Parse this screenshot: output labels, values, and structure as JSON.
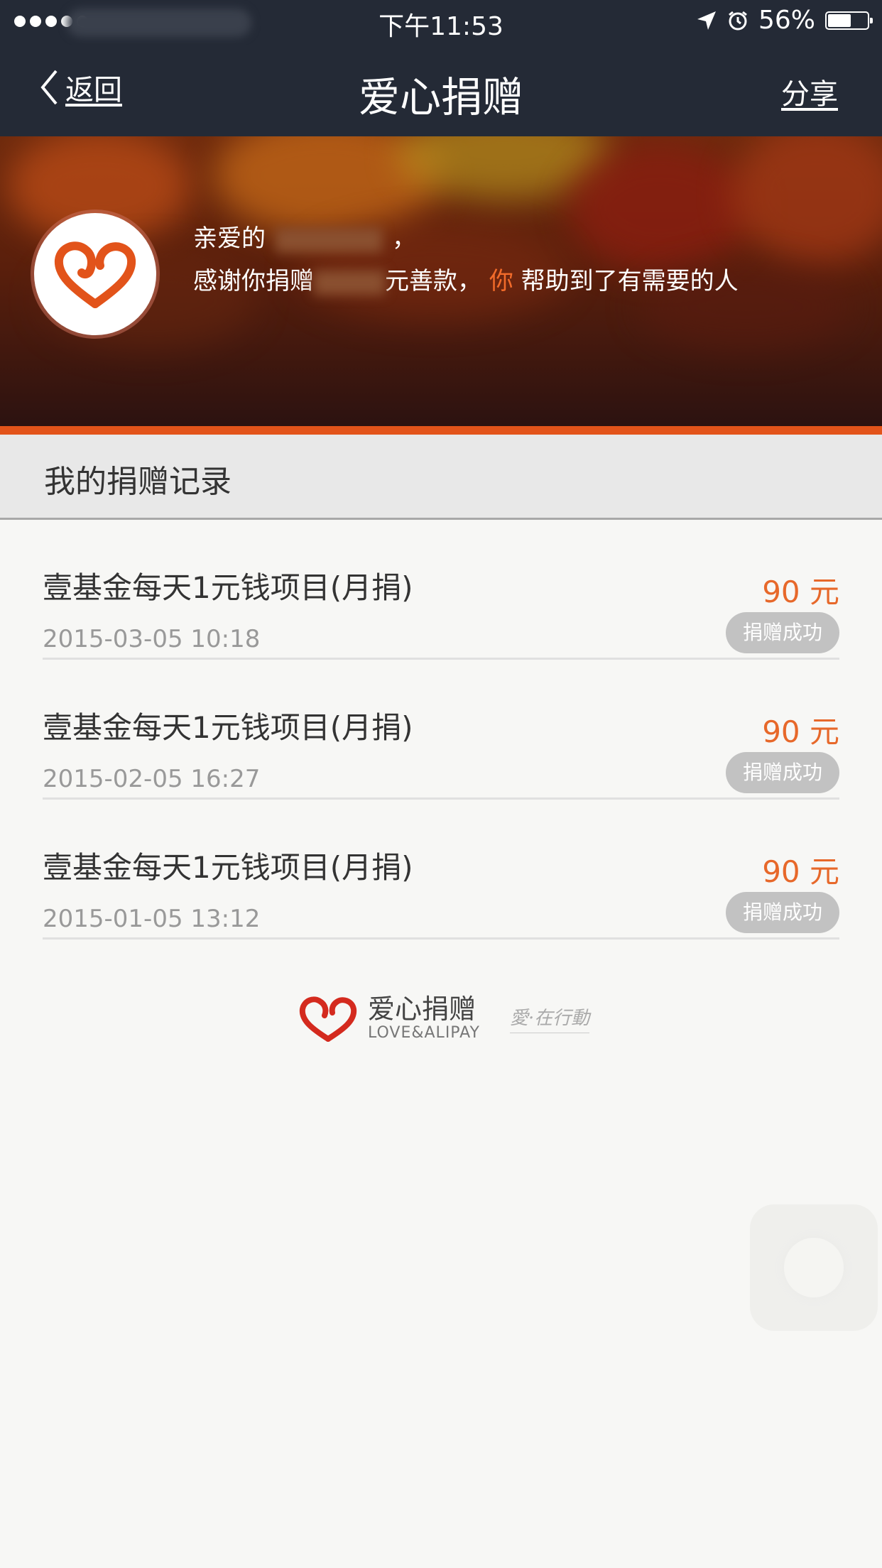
{
  "status_bar": {
    "time": "下午11:53",
    "battery": "56%",
    "battery_level": 0.56,
    "icons": [
      "signal-dots-icon",
      "location-arrow-icon",
      "alarm-clock-icon",
      "battery-icon"
    ]
  },
  "nav": {
    "back_label": "返回",
    "title": "爱心捐赠",
    "share_label": "分享"
  },
  "banner": {
    "greeting": "亲爱的",
    "greeting_comma": "，",
    "thanks_prefix": "感谢你捐赠",
    "thanks_unit": "元善款，",
    "thanks_you": "你",
    "thanks_rest": "帮助到了有需要的人",
    "accent_color": "#f26b2a"
  },
  "section": {
    "title": "我的捐赠记录"
  },
  "records": [
    {
      "title": "壹基金每天1元钱项目(月捐)",
      "time": "2015-03-05 10:18",
      "amount": "90 元",
      "status": "捐赠成功"
    },
    {
      "title": "壹基金每天1元钱项目(月捐)",
      "time": "2015-02-05 16:27",
      "amount": "90 元",
      "status": "捐赠成功"
    },
    {
      "title": "壹基金每天1元钱项目(月捐)",
      "time": "2015-01-05 13:12",
      "amount": "90 元",
      "status": "捐赠成功"
    }
  ],
  "footer": {
    "brand_cn": "爱心捐赠",
    "brand_en": "LOVE&ALIPAY",
    "slogan": "愛·在行動"
  },
  "colors": {
    "nav_bg": "#242a36",
    "amount": "#e7682a",
    "orange_bar": "#e2531a",
    "status_badge": "#c2c2c2"
  }
}
